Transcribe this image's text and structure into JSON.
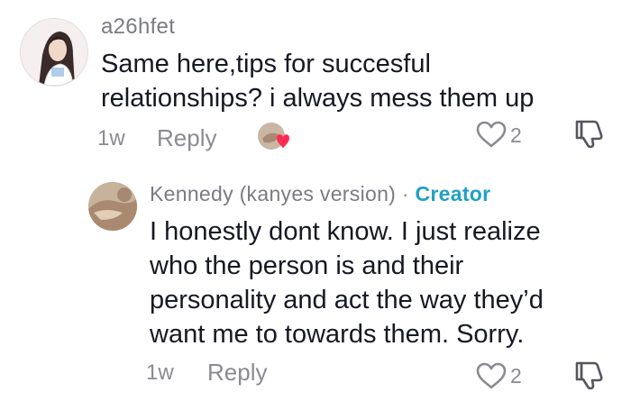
{
  "comments": [
    {
      "username": "a26hfet",
      "text_lines": [
        "Same here,tips for succesful",
        "relationships? i always mess them up"
      ],
      "time": "1w",
      "reply_label": "Reply",
      "like_count": "2"
    },
    {
      "username": "Kennedy (kanyes version)",
      "separator": "·",
      "badge": "Creator",
      "text_lines": [
        "I honestly dont know. I just realize",
        "who the person is and their",
        "personality and act the way they’d",
        "want me to towards them. Sorry."
      ],
      "time": "1w",
      "reply_label": "Reply",
      "like_count": "2"
    }
  ],
  "colors": {
    "text": "#161823",
    "muted": "#8a8b91",
    "creator_badge": "#1fa1c4",
    "heart_reaction": "#fe2c55"
  },
  "icons": {
    "like": "heart-outline-icon",
    "dislike": "thumbs-down-icon",
    "creator_like": "heart-filled-icon"
  }
}
